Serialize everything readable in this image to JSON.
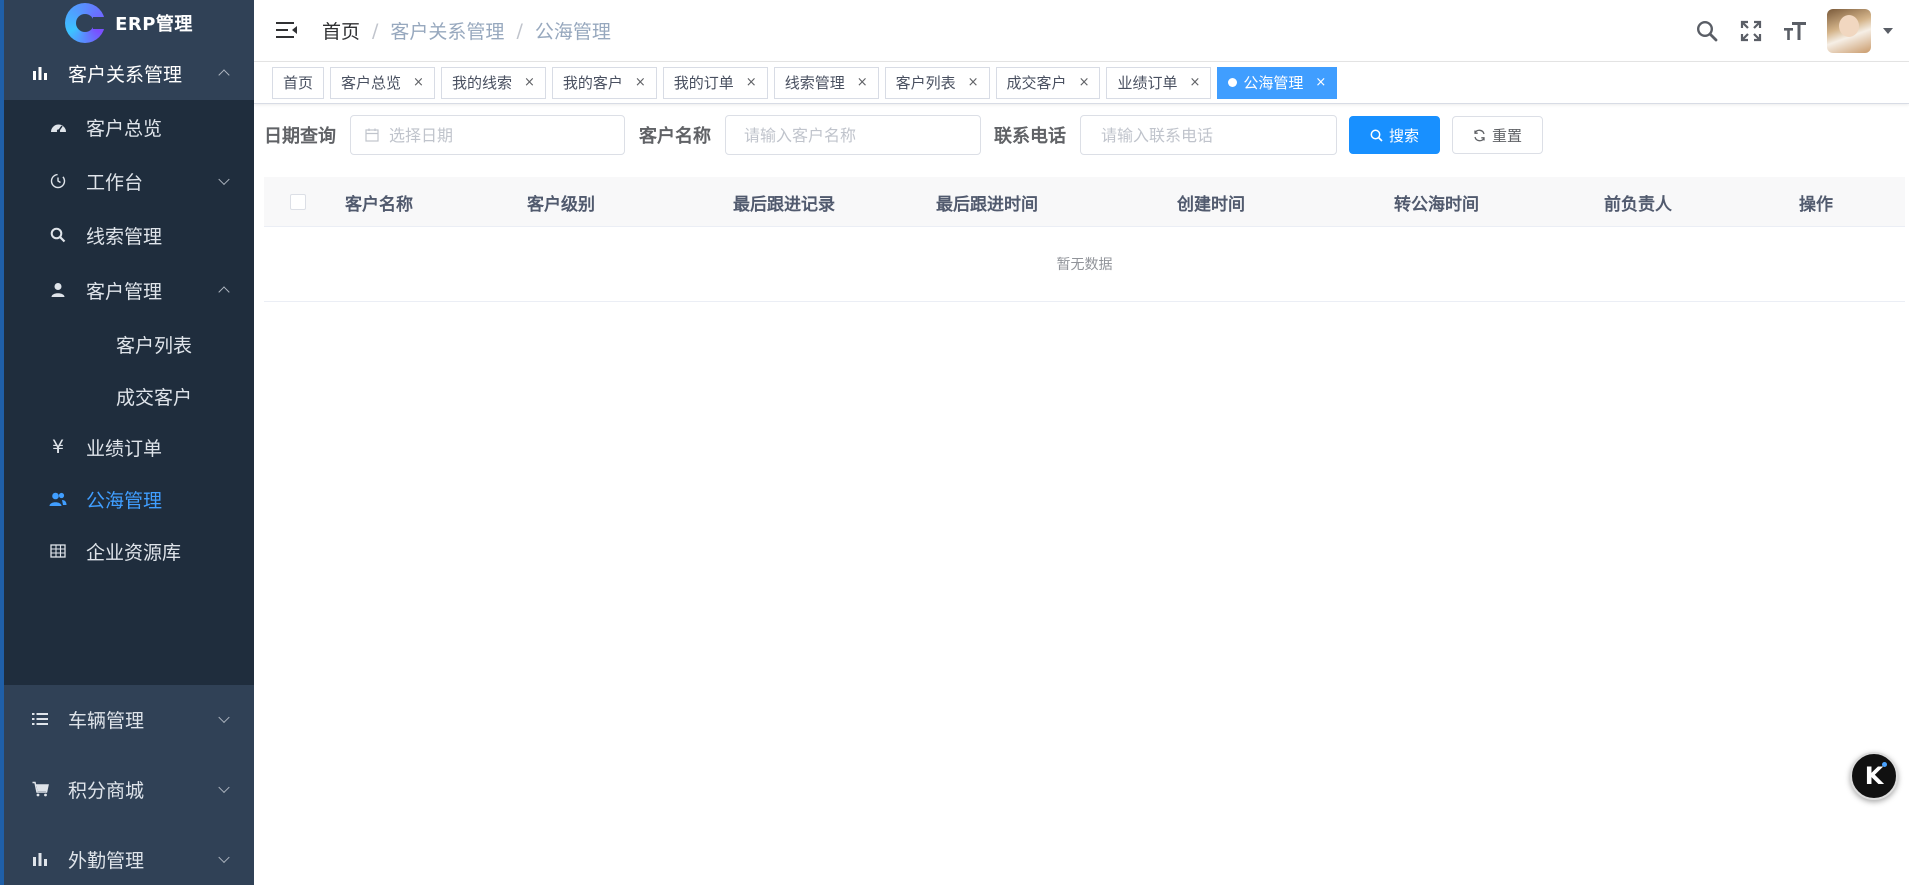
{
  "app": {
    "logo_text": "ERP管理"
  },
  "sidebar": {
    "top": {
      "label": "客户关系管理",
      "icon": "bar-chart-icon",
      "expanded": true
    },
    "items": [
      {
        "label": "客户总览",
        "icon": "dashboard-icon"
      },
      {
        "label": "工作台",
        "icon": "clock-icon"
      },
      {
        "label": "线索管理",
        "icon": "search-icon"
      },
      {
        "label": "客户管理",
        "icon": "user-icon"
      },
      {
        "label": "客户列表"
      },
      {
        "label": "成交客户"
      },
      {
        "label": "业绩订单",
        "icon": "yen-icon"
      },
      {
        "label": "公海管理",
        "icon": "peoples-icon",
        "active": true
      },
      {
        "label": "企业资源库",
        "icon": "table-icon"
      }
    ],
    "groups": [
      {
        "label": "车辆管理",
        "icon": "list-icon"
      },
      {
        "label": "积分商城",
        "icon": "cart-icon"
      },
      {
        "label": "外勤管理",
        "icon": "bar-chart-icon"
      }
    ]
  },
  "breadcrumb": [
    "首页",
    "客户关系管理",
    "公海管理"
  ],
  "header": {
    "separator": "/",
    "icons": [
      "search-icon",
      "fullscreen-icon",
      "font-size-icon",
      "avatar",
      "caret-down-icon"
    ]
  },
  "tags": [
    {
      "label": "首页",
      "closable": false
    },
    {
      "label": "客户总览",
      "closable": true
    },
    {
      "label": "我的线索",
      "closable": true
    },
    {
      "label": "我的客户",
      "closable": true
    },
    {
      "label": "我的订单",
      "closable": true
    },
    {
      "label": "线索管理",
      "closable": true
    },
    {
      "label": "客户列表",
      "closable": true
    },
    {
      "label": "成交客户",
      "closable": true
    },
    {
      "label": "业绩订单",
      "closable": true
    },
    {
      "label": "公海管理",
      "closable": true,
      "active": true
    }
  ],
  "tag_close": "×",
  "search": {
    "date_label": "日期查询",
    "date_placeholder": "选择日期",
    "name_label": "客户名称",
    "name_placeholder": "请输入客户名称",
    "phone_label": "联系电话",
    "phone_placeholder": "请输入联系电话",
    "search_button": "搜索",
    "reset_button": "重置"
  },
  "table": {
    "columns": [
      "客户名称",
      "客户级别",
      "最后跟进记录",
      "最后跟进时间",
      "创建时间",
      "转公海时间",
      "前负责人",
      "操作"
    ],
    "empty_text": "暂无数据"
  },
  "float_button": {
    "label": "K"
  },
  "colors": {
    "sidebar_bg": "#304156",
    "submenu_bg": "#1f2d3d",
    "accent": "#409eff",
    "primary_button": "#1890ff"
  }
}
